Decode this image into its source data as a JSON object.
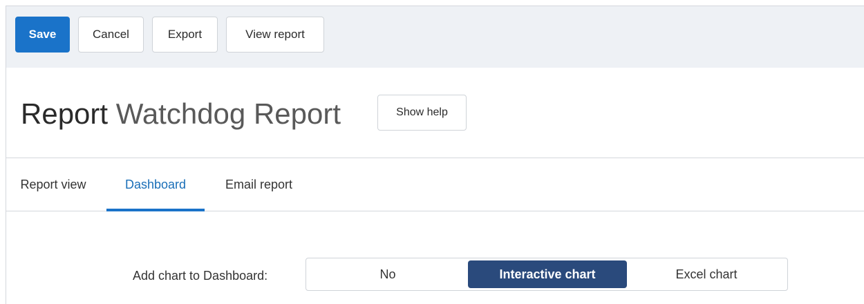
{
  "toolbar": {
    "save_label": "Save",
    "cancel_label": "Cancel",
    "export_label": "Export",
    "view_report_label": "View report"
  },
  "header": {
    "title_prefix": "Report",
    "report_name": "Watchdog Report",
    "help_label": "Show help"
  },
  "tabs": [
    {
      "label": "Report view",
      "active": false
    },
    {
      "label": "Dashboard",
      "active": true
    },
    {
      "label": "Email report",
      "active": false
    }
  ],
  "dashboard": {
    "chart_label": "Add chart to Dashboard:",
    "options": [
      {
        "label": "No",
        "selected": false
      },
      {
        "label": "Interactive chart",
        "selected": true
      },
      {
        "label": "Excel chart",
        "selected": false
      }
    ]
  },
  "colors": {
    "primary": "#1a73c9",
    "selected_option": "#2a4a7c",
    "toolbar_bg": "#eef1f5",
    "active_tab_text": "#1a6fb8"
  }
}
